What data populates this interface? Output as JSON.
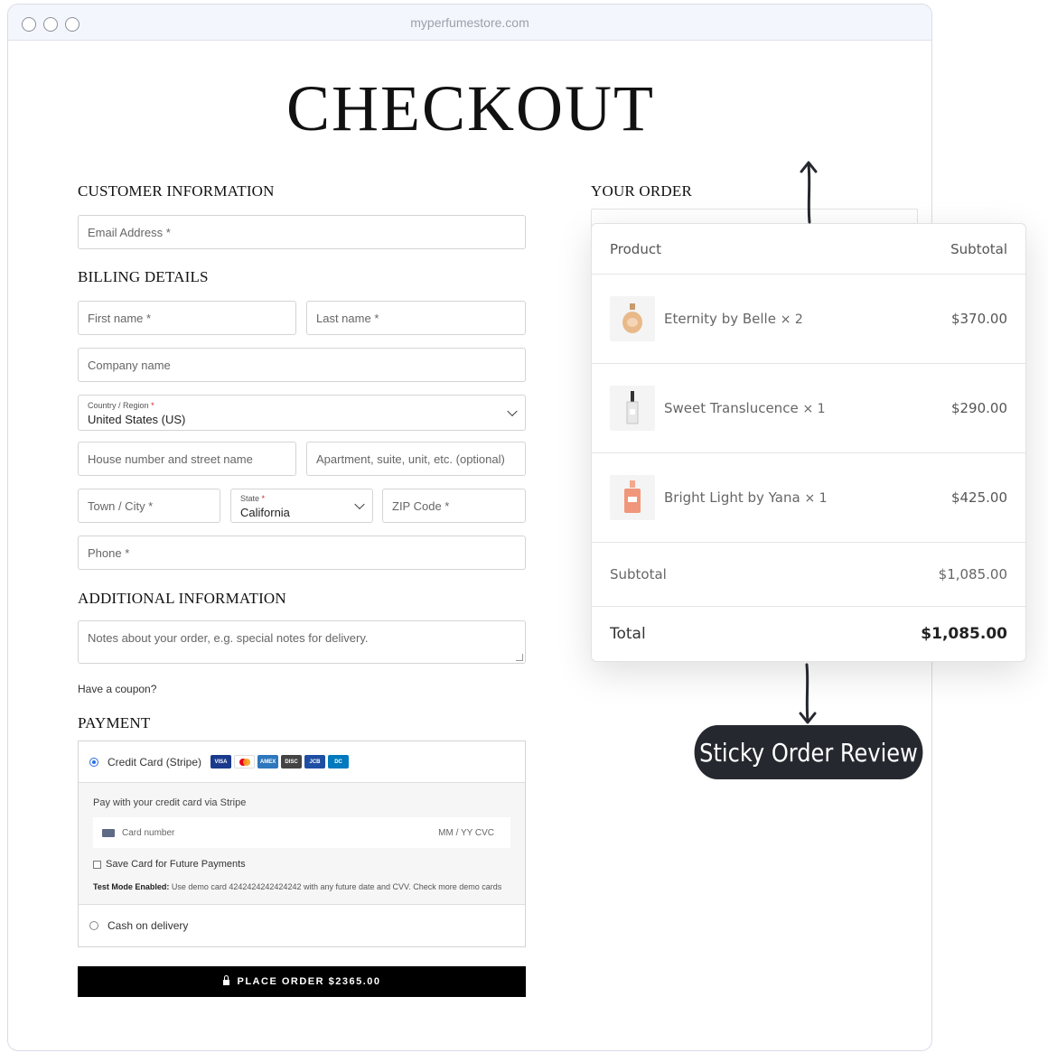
{
  "browser": {
    "url": "myperfumestore.com"
  },
  "page": {
    "title": "CHECKOUT"
  },
  "customer_information": {
    "heading": "CUSTOMER INFORMATION",
    "email_placeholder": "Email Address *"
  },
  "billing": {
    "heading": "BILLING DETAILS",
    "first_name": "First name *",
    "last_name": "Last name *",
    "company": "Company name",
    "country_label": "Country / Region",
    "country_required": "*",
    "country_value": "United States (US)",
    "street": "House number and street name",
    "apartment": "Apartment, suite, unit, etc. (optional)",
    "city": "Town / City *",
    "state_label": "State",
    "state_required": "*",
    "state_value": "California",
    "zip": "ZIP Code *",
    "phone": "Phone *"
  },
  "additional": {
    "heading": "ADDITIONAL INFORMATION",
    "notes_placeholder": "Notes about your order, e.g. special notes for delivery."
  },
  "coupon": {
    "text": "Have a coupon?"
  },
  "payment": {
    "heading": "PAYMENT",
    "credit_card_label": "Credit Card (Stripe)",
    "card_brands": [
      "VISA",
      "MC",
      "AMEX",
      "DISC",
      "JCB",
      "DC"
    ],
    "stripe_description": "Pay with your credit card via Stripe",
    "card_number_placeholder": "Card number",
    "card_expiry_cvc": "MM / YY  CVC",
    "save_card_label": "Save Card for Future Payments",
    "test_mode_title": "Test Mode Enabled:",
    "test_mode_text": " Use demo card 4242424242424242 with any future date and CVV. Check more demo cards",
    "cod_label": "Cash on delivery",
    "place_order": "PLACE ORDER $2365.00"
  },
  "your_order": {
    "heading": "YOUR ORDER",
    "col_product": "Product",
    "col_subtotal": "Subtotal",
    "items": [
      {
        "name": "Eternity by Belle",
        "qty": "× 2",
        "price": "$370.00",
        "thumb_color": "#e9b98a"
      },
      {
        "name": "Sweet Translucence",
        "qty": "× 1",
        "price": "$290.00",
        "thumb_color": "#d8d8d8"
      },
      {
        "name": "Bright Light by Yana",
        "qty": "× 1",
        "price": "$425.00",
        "thumb_color": "#f0967a"
      }
    ],
    "subtotal_label": "Subtotal",
    "subtotal_value": "$1,085.00",
    "total_label": "Total",
    "total_value": "$1,085.00"
  },
  "callout": {
    "label": "Sticky Order Review"
  },
  "colors": {
    "accent": "#2b6de5",
    "button": "#000000",
    "callout_bg": "#25282e"
  }
}
